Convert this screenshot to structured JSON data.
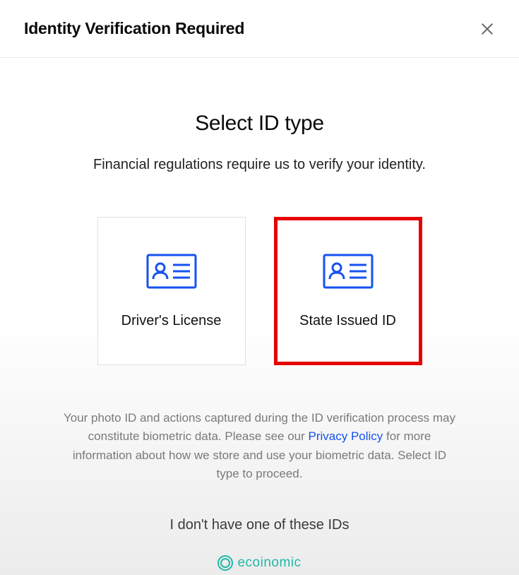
{
  "header": {
    "title": "Identity Verification Required"
  },
  "main": {
    "title": "Select ID type",
    "subtitle": "Financial regulations require us to verify your identity.",
    "options": [
      {
        "label": "Driver's License"
      },
      {
        "label": "State Issued ID"
      }
    ],
    "disclaimer_pre": "Your photo ID and actions captured during the ID verification process may constitute biometric data. Please see our ",
    "disclaimer_link": "Privacy Policy",
    "disclaimer_post": " for more information about how we store and use your biometric data. Select ID type to proceed.",
    "no_id_label": "I don't have one of these IDs"
  },
  "footer": {
    "brand": "ecoinomic"
  }
}
